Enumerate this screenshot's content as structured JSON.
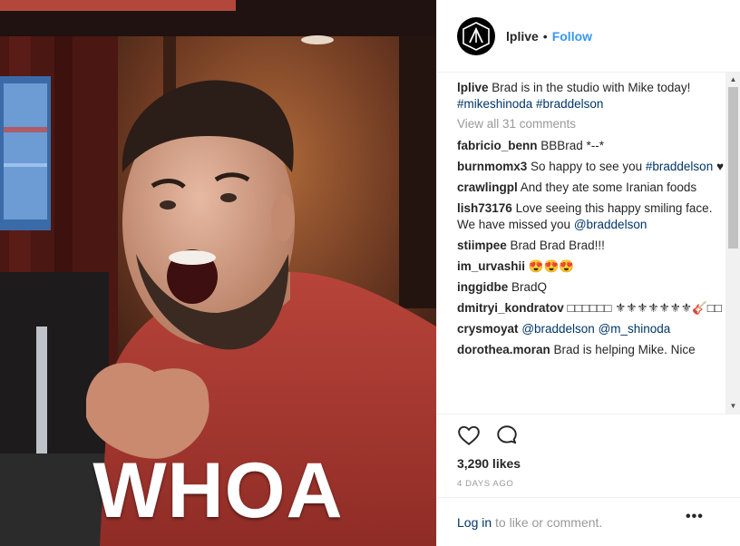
{
  "header": {
    "username": "lplive",
    "separator": "•",
    "follow_label": "Follow",
    "avatar_icon": "linkin-park-logo-icon"
  },
  "caption": {
    "username": "lplive",
    "text": "Brad is in the studio with Mike today!",
    "tags": "#mikeshinoda #braddelson"
  },
  "view_all_label": "View all 31 comments",
  "comments": [
    {
      "user": "fabricio_benn",
      "text": "BBBrad *--*"
    },
    {
      "user": "burnmomx3",
      "text": "So happy to see you",
      "tag": "#braddelson",
      "after": "♥"
    },
    {
      "user": "crawlingpl",
      "text": "And they ate some Iranian foods"
    },
    {
      "user": "lish73176",
      "text": "Love seeing this happy smiling face. We have missed you",
      "tag": "@braddelson"
    },
    {
      "user": "stiimpee",
      "text": "Brad Brad Brad!!!"
    },
    {
      "user": "im_urvashii",
      "text": "😍😍😍"
    },
    {
      "user": "inggidbe",
      "text": "BradQ"
    },
    {
      "user": "dmitryi_kondratov",
      "text": "□□□□□□ ⚜⚜⚜⚜⚜⚜⚜🎸□□"
    },
    {
      "user": "crysmoyat",
      "text": "",
      "tag": "@braddelson @m_shinoda"
    },
    {
      "user": "dorothea.moran",
      "text": "Brad is helping Mike. Nice"
    }
  ],
  "media": {
    "overlay_text": "WHOA"
  },
  "actions": {
    "like_icon": "heart-icon",
    "comment_icon": "comment-bubble-icon",
    "likes_label": "3,290 likes",
    "time_label": "4 DAYS AGO"
  },
  "footer": {
    "login_link": "Log in",
    "login_rest": " to like or comment.",
    "more_label": "•••"
  },
  "scrollbar": {
    "up_arrow": "▲",
    "down_arrow": "▼"
  }
}
